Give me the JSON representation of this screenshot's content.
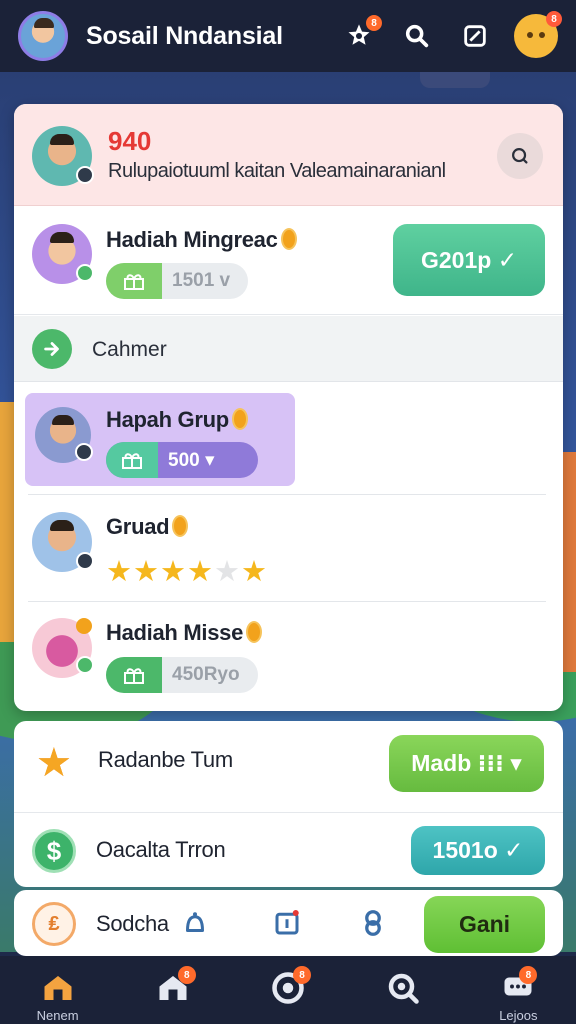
{
  "app": {
    "title": "Sosail Nndansial",
    "accent": "#3fb58a",
    "topbar_icons": [
      {
        "name": "star-settings-icon",
        "badge": "8"
      },
      {
        "name": "search-icon",
        "badge": ""
      },
      {
        "name": "edit-icon",
        "badge": ""
      },
      {
        "name": "emoji-face-icon",
        "badge": "8"
      }
    ]
  },
  "header": {
    "score": "940",
    "subtitle": "Rulupaiotuuml kaitan Valeamainaranianl"
  },
  "rows": {
    "mingreac": {
      "title": "Hadiah Mingreac",
      "pill_value": "1501 v",
      "button": "G201p ✓"
    },
    "cahmer": {
      "label": "Cahmer"
    },
    "grup": {
      "title": "Hapah Grup",
      "pill_value": "500 ▾"
    },
    "grad": {
      "title": "Gruad",
      "rating": 5,
      "stars": [
        "★",
        "★",
        "★",
        "★",
        "★",
        "★"
      ],
      "stars_on": [
        true,
        true,
        true,
        true,
        false,
        true
      ]
    },
    "misse": {
      "title": "Hadiah Misse",
      "pill_value": "450Ryo"
    }
  },
  "cards": {
    "radanbe": {
      "label": "Radanbe Tum",
      "button": "Madb ⁝⁝⁝ ▾"
    },
    "oacalta": {
      "label": "Oacalta Trron",
      "button": "1501o ✓"
    },
    "sodcha": {
      "label": "Sodcha",
      "button": "Gani"
    }
  },
  "bottom_nav": [
    {
      "name": "home",
      "label": "Nenem",
      "badge": ""
    },
    {
      "name": "house",
      "label": "",
      "badge": "8"
    },
    {
      "name": "target",
      "label": "",
      "badge": "8"
    },
    {
      "name": "search",
      "label": "",
      "badge": ""
    },
    {
      "name": "chat",
      "label": "Lejoos",
      "badge": "8"
    }
  ]
}
